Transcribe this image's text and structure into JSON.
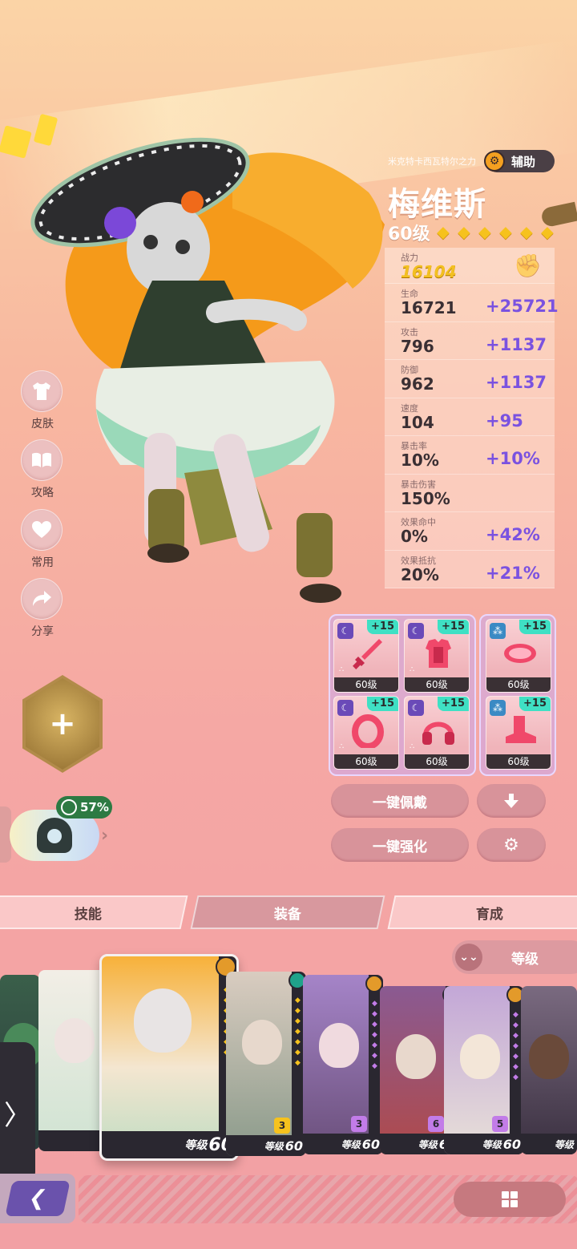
{
  "hero": {
    "subtitle": "米克特卡西瓦特尔之力",
    "role": "辅助",
    "name": "梅维斯",
    "level": "60级",
    "stars": 7
  },
  "stats": {
    "power_label": "战力",
    "power_value": "16104",
    "rows": [
      {
        "label": "生命",
        "base": "16721",
        "bonus": "+25721"
      },
      {
        "label": "攻击",
        "base": "796",
        "bonus": "+1137"
      },
      {
        "label": "防御",
        "base": "962",
        "bonus": "+1137"
      },
      {
        "label": "速度",
        "base": "104",
        "bonus": "+95"
      },
      {
        "label": "暴击率",
        "base": "10%",
        "bonus": "+10%"
      },
      {
        "label": "暴击伤害",
        "base": "150%",
        "bonus": ""
      },
      {
        "label": "效果命中",
        "base": "0%",
        "bonus": "+42%"
      },
      {
        "label": "效果抵抗",
        "base": "20%",
        "bonus": "+21%"
      }
    ]
  },
  "side_menu": [
    {
      "label": "皮肤",
      "icon": "shirt-icon"
    },
    {
      "label": "攻略",
      "icon": "book-icon"
    },
    {
      "label": "常用",
      "icon": "heart-icon"
    },
    {
      "label": "分享",
      "icon": "share-icon"
    }
  ],
  "pet": {
    "icon": "plus-icon"
  },
  "skill": {
    "percent": "57%"
  },
  "equipment": [
    {
      "plus": "+15",
      "level": "60级",
      "type": "sword",
      "set": "moon"
    },
    {
      "plus": "+15",
      "level": "60级",
      "type": "armor",
      "set": "moon"
    },
    {
      "plus": "+15",
      "level": "60级",
      "type": "goggles",
      "set": "triad"
    },
    {
      "plus": "+15",
      "level": "60级",
      "type": "ring",
      "set": "moon"
    },
    {
      "plus": "+15",
      "level": "60级",
      "type": "headphones",
      "set": "moon"
    },
    {
      "plus": "+15",
      "level": "60级",
      "type": "boots",
      "set": "triad"
    }
  ],
  "actions": {
    "auto_equip": "一键佩戴",
    "auto_enhance": "一键强化"
  },
  "tabs": [
    "技能",
    "装备",
    "育成"
  ],
  "active_tab": 1,
  "sort": {
    "label": "等级"
  },
  "roster": [
    {
      "level_prefix": "等级",
      "level": "60",
      "rank": "",
      "elem": "orange"
    },
    {
      "level_prefix": "等级",
      "level": "60",
      "rank": "3",
      "elem": "green"
    },
    {
      "level_prefix": "等级",
      "level": "60",
      "rank": "3",
      "elem": "orange"
    },
    {
      "level_prefix": "等级",
      "level": "60",
      "rank": "6",
      "elem": "green"
    },
    {
      "level_prefix": "等级",
      "level": "60",
      "rank": "5",
      "elem": "orange"
    },
    {
      "level_prefix": "等级",
      "level": "",
      "rank": "",
      "elem": "purple"
    }
  ],
  "colors": {
    "bonus": "#7a52e0",
    "power": "#f3c020",
    "equip_plus": "#3fe0c4",
    "accent_pink": "#d8939a"
  }
}
